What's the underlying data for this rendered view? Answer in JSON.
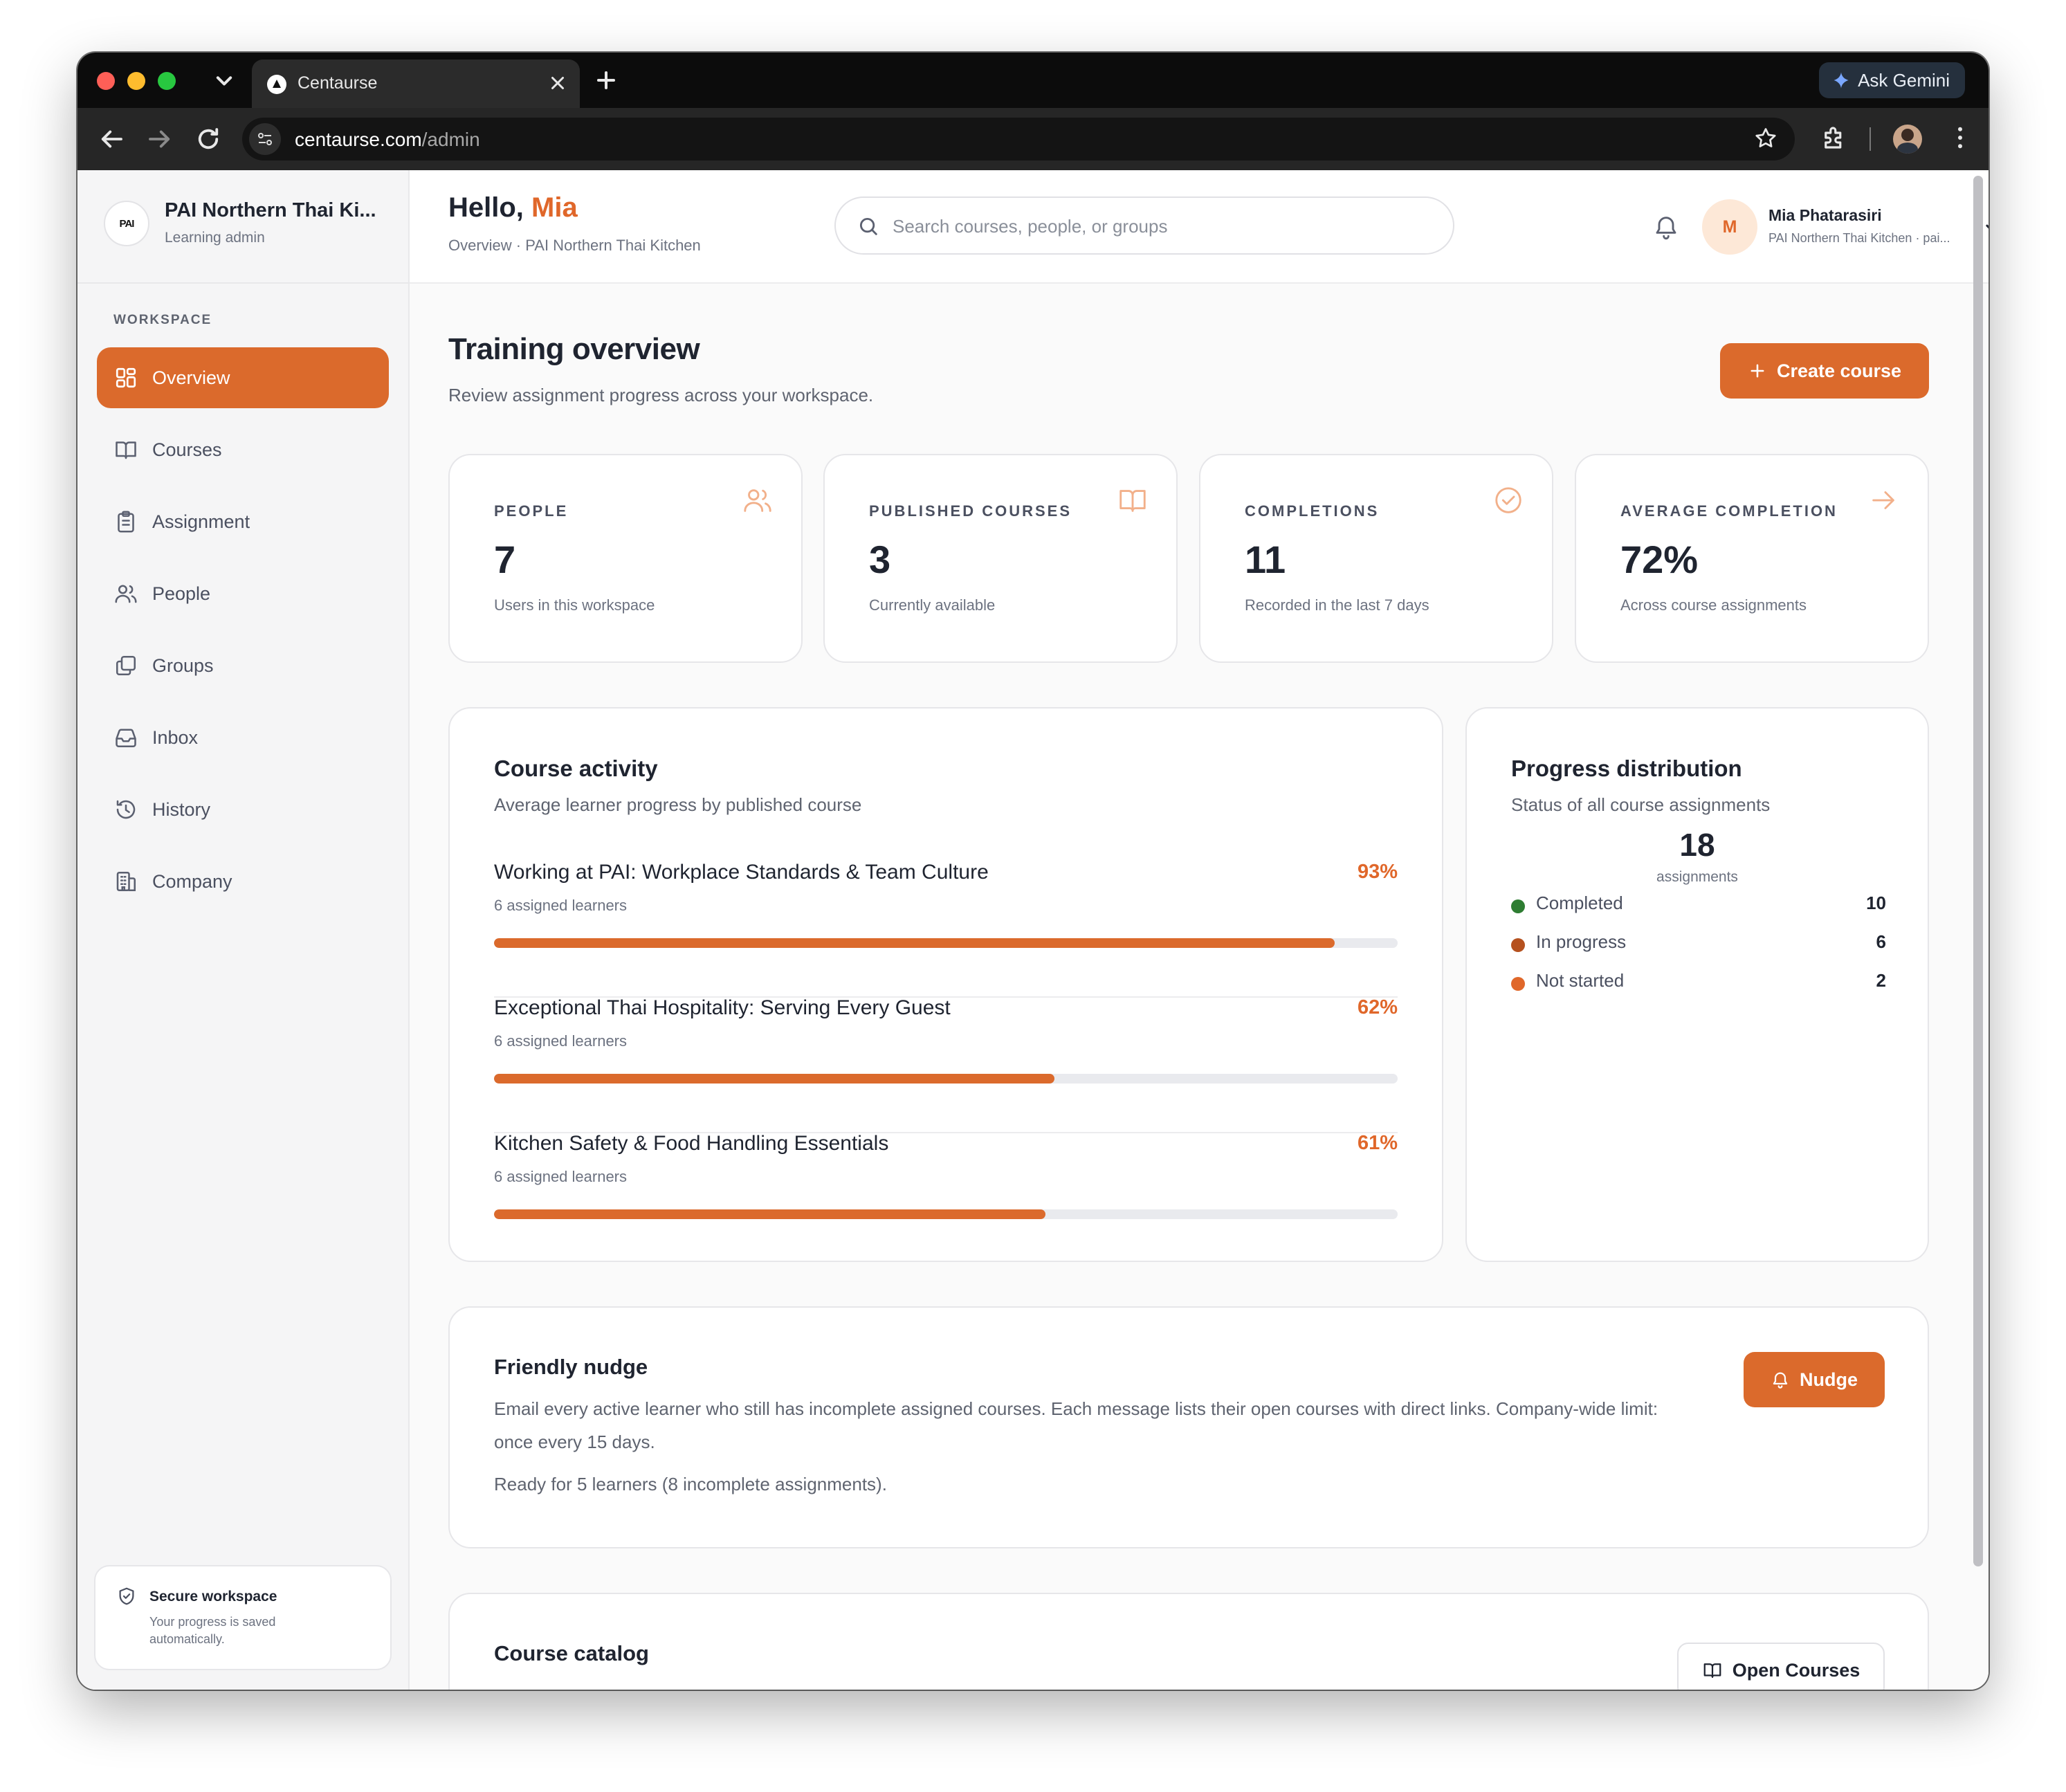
{
  "browser": {
    "tab_title": "Centaurse",
    "url_host": "centaurse.com",
    "url_path": "/admin",
    "gemini_label": "Ask Gemini"
  },
  "sidebar": {
    "brand_name": "PAI Northern Thai Ki...",
    "brand_role": "Learning admin",
    "brand_logo_text": "PAI",
    "section_label": "WORKSPACE",
    "items": [
      {
        "label": "Overview",
        "icon": "grid-icon",
        "active": true
      },
      {
        "label": "Courses",
        "icon": "book-icon"
      },
      {
        "label": "Assignment",
        "icon": "clipboard-icon"
      },
      {
        "label": "People",
        "icon": "users-icon"
      },
      {
        "label": "Groups",
        "icon": "copy-icon"
      },
      {
        "label": "Inbox",
        "icon": "inbox-icon"
      },
      {
        "label": "History",
        "icon": "history-icon"
      },
      {
        "label": "Company",
        "icon": "building-icon"
      }
    ],
    "secure": {
      "title": "Secure workspace",
      "subtitle": "Your progress is saved automatically."
    }
  },
  "header": {
    "greeting": "Hello,",
    "name": "Mia",
    "breadcrumb": "Overview · PAI Northern Thai Kitchen",
    "search_placeholder": "Search courses, people, or groups",
    "user_initial": "M",
    "user_name": "Mia Phatarasiri",
    "user_org": "PAI Northern Thai Kitchen · pai..."
  },
  "main": {
    "title": "Training overview",
    "subtitle": "Review assignment progress across your workspace.",
    "create_label": "Create course",
    "stats": [
      {
        "label": "PEOPLE",
        "value": "7",
        "sub": "Users in this workspace",
        "icon": "users-icon"
      },
      {
        "label": "PUBLISHED COURSES",
        "value": "3",
        "sub": "Currently available",
        "icon": "book-icon"
      },
      {
        "label": "COMPLETIONS",
        "value": "11",
        "sub": "Recorded in the last 7 days",
        "icon": "check-circle-icon"
      },
      {
        "label": "AVERAGE COMPLETION",
        "value": "72%",
        "sub": "Across course assignments",
        "icon": "arrow-right-icon"
      }
    ],
    "activity": {
      "title": "Course activity",
      "subtitle": "Average learner progress by published course",
      "courses": [
        {
          "name": "Working at PAI: Workplace Standards & Team Culture",
          "pct_label": "93%",
          "progress": 0.93,
          "learners": "6 assigned learners"
        },
        {
          "name": "Exceptional Thai Hospitality: Serving Every Guest",
          "pct_label": "62%",
          "progress": 0.62,
          "learners": "6 assigned learners"
        },
        {
          "name": "Kitchen Safety & Food Handling Essentials",
          "pct_label": "61%",
          "progress": 0.61,
          "learners": "6 assigned learners"
        }
      ]
    },
    "distribution": {
      "title": "Progress distribution",
      "subtitle": "Status of all course assignments",
      "total": "18",
      "total_label": "assignments",
      "items": [
        {
          "name": "Completed",
          "value": "10",
          "color": "#2e7d32"
        },
        {
          "name": "In progress",
          "value": "6",
          "color": "#b5511f"
        },
        {
          "name": "Not started",
          "value": "2",
          "color": "#e0672a"
        }
      ]
    },
    "nudge": {
      "title": "Friendly nudge",
      "description": "Email every active learner who still has incomplete assigned courses. Each message lists their open courses with direct links. Company-wide limit: once every 15 days.",
      "ready": "Ready for 5 learners (8 incomplete assignments).",
      "button": "Nudge"
    },
    "catalog": {
      "title": "Course catalog",
      "button": "Open Courses"
    }
  },
  "colors": {
    "accent": "#db6a2c",
    "accent_text": "#e0672a"
  }
}
